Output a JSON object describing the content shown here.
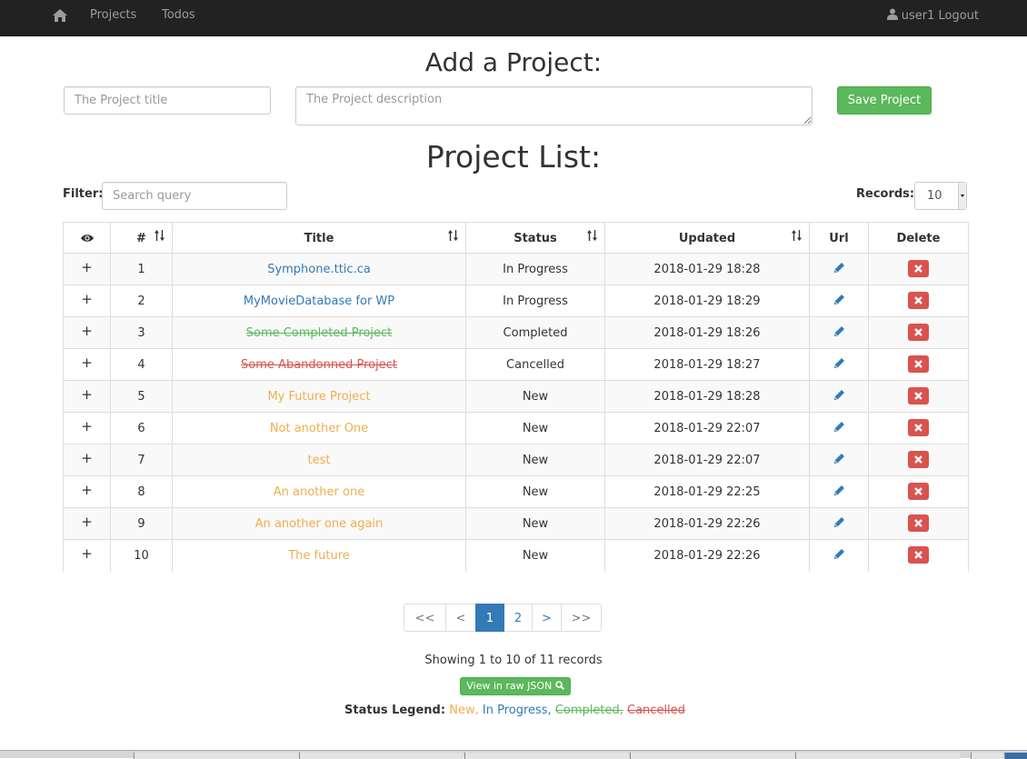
{
  "navbar": {
    "home_icon": "home-icon",
    "links": [
      "Projects",
      "Todos"
    ],
    "user_icon": "user-icon",
    "user_text": "user1 Logout"
  },
  "add_form": {
    "heading": "Add a Project:",
    "title_placeholder": "The Project title",
    "description_placeholder": "The Project description",
    "save_label": "Save Project"
  },
  "list": {
    "heading": "Project List:",
    "filter_label": "Filter:",
    "filter_placeholder": "Search query",
    "records_label": "Records:",
    "records_value": "10"
  },
  "table": {
    "columns": [
      "",
      "#",
      "Title",
      "Status",
      "Updated",
      "Url",
      "Delete"
    ],
    "eye_icon": "eye-icon",
    "sort_icon": "sort-icon",
    "edit_icon": "pencil-icon",
    "delete_icon": "remove-icon",
    "rows": [
      {
        "expand": "+",
        "num": "1",
        "title": "Symphone.ttic.ca",
        "status": "In Progress",
        "updated": "2018-01-29 18:28"
      },
      {
        "expand": "+",
        "num": "2",
        "title": "MyMovieDatabase for WP",
        "status": "In Progress",
        "updated": "2018-01-29 18:29"
      },
      {
        "expand": "+",
        "num": "3",
        "title": "Some Completed Project",
        "status": "Completed",
        "updated": "2018-01-29 18:26"
      },
      {
        "expand": "+",
        "num": "4",
        "title": "Some Abandonned Project",
        "status": "Cancelled",
        "updated": "2018-01-29 18:27"
      },
      {
        "expand": "+",
        "num": "5",
        "title": "My Future Project",
        "status": "New",
        "updated": "2018-01-29 18:28"
      },
      {
        "expand": "+",
        "num": "6",
        "title": "Not another One",
        "status": "New",
        "updated": "2018-01-29 22:07"
      },
      {
        "expand": "+",
        "num": "7",
        "title": "test",
        "status": "New",
        "updated": "2018-01-29 22:07"
      },
      {
        "expand": "+",
        "num": "8",
        "title": "An another one",
        "status": "New",
        "updated": "2018-01-29 22:25"
      },
      {
        "expand": "+",
        "num": "9",
        "title": "An another one again",
        "status": "New",
        "updated": "2018-01-29 22:26"
      },
      {
        "expand": "+",
        "num": "10",
        "title": "The future",
        "status": "New",
        "updated": "2018-01-29 22:26"
      }
    ]
  },
  "pagination": {
    "items": [
      "<<",
      "<",
      "1",
      "2",
      ">",
      ">>"
    ],
    "active": "1"
  },
  "footer": {
    "showing": "Showing 1 to 10 of 11 records",
    "json_button": "View in raw JSON",
    "json_icon": "search-icon",
    "legend_label": "Status Legend:",
    "legend": [
      {
        "text": "New,",
        "status": "New"
      },
      {
        "text": "In Progress,",
        "status": "In Progress"
      },
      {
        "text": "Completed,",
        "status": "Completed"
      },
      {
        "text": "Cancelled",
        "status": "Cancelled"
      }
    ]
  },
  "colors": {
    "navbar_bg": "#222222",
    "new": "#f0ad4e",
    "in_progress": "#337ab7",
    "completed": "#5cb85c",
    "cancelled": "#d9534f",
    "primary": "#337ab7",
    "success": "#5cb85c",
    "danger": "#d9534f"
  }
}
